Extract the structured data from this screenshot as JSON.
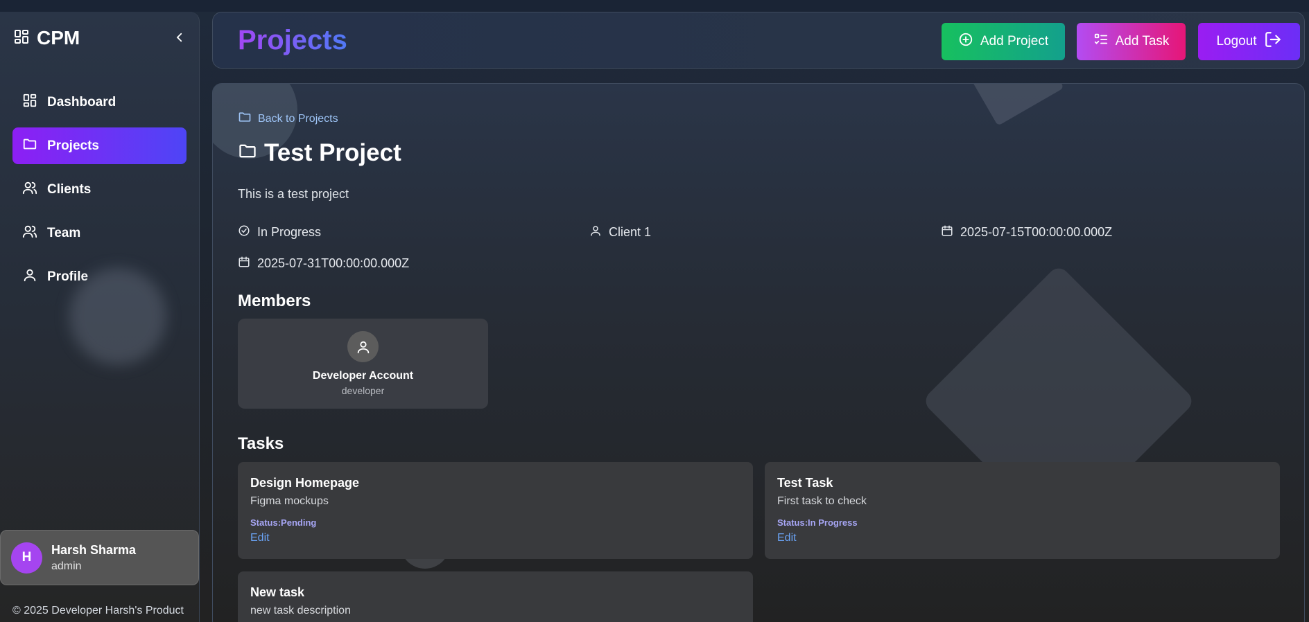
{
  "sidebar": {
    "brand": "CPM",
    "items": [
      {
        "label": "Dashboard",
        "icon": "dashboard-icon",
        "active": false
      },
      {
        "label": "Projects",
        "icon": "folder-icon",
        "active": true
      },
      {
        "label": "Clients",
        "icon": "users-icon",
        "active": false
      },
      {
        "label": "Team",
        "icon": "users-icon",
        "active": false
      },
      {
        "label": "Profile",
        "icon": "user-icon",
        "active": false
      }
    ],
    "user": {
      "initial": "H",
      "name": "Harsh Sharma",
      "role": "admin"
    },
    "footer": "© 2025 Developer Harsh's Product"
  },
  "header": {
    "title": "Projects",
    "add_project_label": "Add Project",
    "add_task_label": "Add Task",
    "logout_label": "Logout"
  },
  "project": {
    "back_label": "Back to Projects",
    "title": "Test Project",
    "description": "This is a test project",
    "status": "In Progress",
    "client": "Client 1",
    "start_date": "2025-07-15T00:00:00.000Z",
    "end_date": "2025-07-31T00:00:00.000Z"
  },
  "members": {
    "heading": "Members",
    "list": [
      {
        "name": "Developer Account",
        "role": "developer"
      }
    ]
  },
  "tasks": {
    "heading": "Tasks",
    "list": [
      {
        "title": "Design Homepage",
        "description": "Figma mockups",
        "status": "Status:Pending",
        "edit_label": "Edit"
      },
      {
        "title": "Test Task",
        "description": "First task to check",
        "status": "Status:In Progress",
        "edit_label": "Edit"
      },
      {
        "title": "New task",
        "description": "new task description",
        "status": "",
        "edit_label": ""
      }
    ]
  },
  "colors": {
    "accent_purple": "#8d1ff4",
    "accent_blue": "#4e45f6",
    "success_green": "#17c05f",
    "pink": "#e61677",
    "link_blue": "#6aa3f5"
  }
}
